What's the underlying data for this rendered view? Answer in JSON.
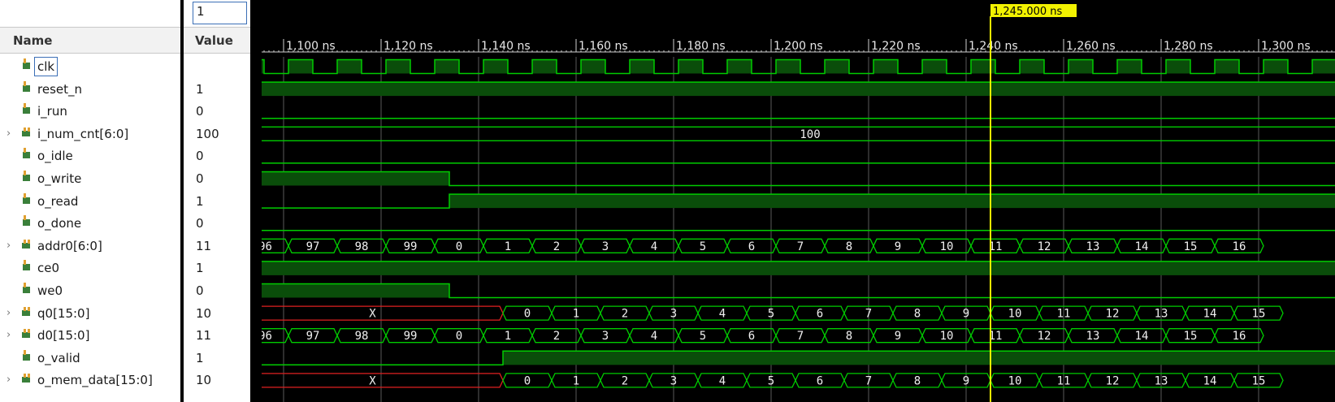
{
  "columns": {
    "name_header": "Name",
    "value_header": "Value"
  },
  "signals": [
    {
      "name": "clk",
      "value": "1",
      "kind": "bit",
      "selected": true
    },
    {
      "name": "reset_n",
      "value": "1",
      "kind": "bit"
    },
    {
      "name": "i_run",
      "value": "0",
      "kind": "bit"
    },
    {
      "name": "i_num_cnt[6:0]",
      "value": "100",
      "kind": "bus",
      "expandable": true
    },
    {
      "name": "o_idle",
      "value": "0",
      "kind": "bit"
    },
    {
      "name": "o_write",
      "value": "0",
      "kind": "bit"
    },
    {
      "name": "o_read",
      "value": "1",
      "kind": "bit"
    },
    {
      "name": "o_done",
      "value": "0",
      "kind": "bit"
    },
    {
      "name": "addr0[6:0]",
      "value": "11",
      "kind": "bus",
      "expandable": true
    },
    {
      "name": "ce0",
      "value": "1",
      "kind": "bit"
    },
    {
      "name": "we0",
      "value": "0",
      "kind": "bit"
    },
    {
      "name": "q0[15:0]",
      "value": "10",
      "kind": "bus",
      "expandable": true
    },
    {
      "name": "d0[15:0]",
      "value": "11",
      "kind": "bus",
      "expandable": true
    },
    {
      "name": "o_valid",
      "value": "1",
      "kind": "bit"
    },
    {
      "name": "o_mem_data[15:0]",
      "value": "10",
      "kind": "bus",
      "expandable": true
    }
  ],
  "timeline": {
    "ticks": [
      "1,100 ns",
      "1,120 ns",
      "1,140 ns",
      "1,160 ns",
      "1,180 ns",
      "1,200 ns",
      "1,220 ns",
      "1,240 ns",
      "1,260 ns",
      "1,280 ns",
      "1,300 ns"
    ],
    "cursor_label": "1,245.000 ns",
    "cursor_time_ns": 1245,
    "view_start_ns": 1095.5,
    "view_end_ns": 1315.5,
    "clk_period_ns": 10
  },
  "waves": {
    "i_num_cnt": "100",
    "o_write_fall_ns": 1134,
    "o_read_rise_ns": 1134,
    "we0_fall_ns": 1134,
    "o_valid_rise_ns": 1145,
    "addr0_values": [
      "96",
      "97",
      "98",
      "99",
      "0",
      "1",
      "2",
      "3",
      "4",
      "5",
      "6",
      "7",
      "8",
      "9",
      "10",
      "11",
      "12",
      "13",
      "14",
      "15",
      "16"
    ],
    "d0_values": [
      "96",
      "97",
      "98",
      "99",
      "0",
      "1",
      "2",
      "3",
      "4",
      "5",
      "6",
      "7",
      "8",
      "9",
      "10",
      "11",
      "12",
      "13",
      "14",
      "15",
      "16"
    ],
    "q0_values": [
      "0",
      "1",
      "2",
      "3",
      "4",
      "5",
      "6",
      "7",
      "8",
      "9",
      "10",
      "11",
      "12",
      "13",
      "14",
      "15"
    ],
    "o_mem_data_values": [
      "0",
      "1",
      "2",
      "3",
      "4",
      "5",
      "6",
      "7",
      "8",
      "9",
      "10",
      "11",
      "12",
      "13",
      "14",
      "15"
    ],
    "undefined_label": "X"
  },
  "colors": {
    "wave_green": "#00cc00",
    "wave_fill": "#0a4d0a",
    "undefined_red": "#e02020",
    "cursor_yellow": "#f2f200",
    "grid": "#5a5a5a"
  },
  "icons": {
    "bit": "signal-bit-icon",
    "bus": "signal-bus-icon",
    "expand": "chevron-right-icon"
  }
}
